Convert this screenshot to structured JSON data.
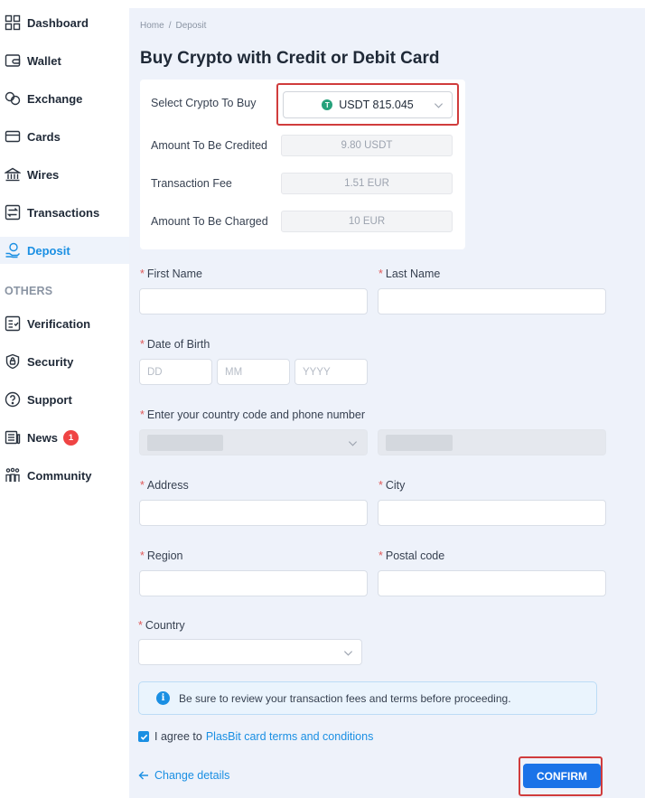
{
  "sidebar": {
    "items": [
      {
        "label": "Dashboard",
        "icon": "dashboard-icon"
      },
      {
        "label": "Wallet",
        "icon": "wallet-icon"
      },
      {
        "label": "Exchange",
        "icon": "exchange-icon"
      },
      {
        "label": "Cards",
        "icon": "card-icon"
      },
      {
        "label": "Wires",
        "icon": "bank-icon"
      },
      {
        "label": "Transactions",
        "icon": "transactions-icon"
      },
      {
        "label": "Deposit",
        "icon": "deposit-icon",
        "active": true
      }
    ],
    "section_label": "OTHERS",
    "other_items": [
      {
        "label": "Verification",
        "icon": "verification-icon"
      },
      {
        "label": "Security",
        "icon": "lock-icon"
      },
      {
        "label": "Support",
        "icon": "help-icon"
      },
      {
        "label": "News",
        "icon": "news-icon",
        "badge": "1"
      },
      {
        "label": "Community",
        "icon": "community-icon"
      }
    ]
  },
  "breadcrumb": {
    "home": "Home",
    "separator": "/",
    "current": "Deposit"
  },
  "page_title": "Buy Crypto with Credit or Debit Card",
  "summary": {
    "select_label": "Select Crypto To Buy",
    "selected_coin": "USDT 815.045",
    "coin_symbol": "T",
    "credited_label": "Amount To Be Credited",
    "credited_value": "9.80 USDT",
    "fee_label": "Transaction Fee",
    "fee_value": "1.51 EUR",
    "charged_label": "Amount To Be Charged",
    "charged_value": "10 EUR"
  },
  "form": {
    "required_mark": "*",
    "first_name_label": "First Name",
    "last_name_label": "Last Name",
    "dob_label": "Date of Birth",
    "dob_day_placeholder": "DD",
    "dob_month_placeholder": "MM",
    "dob_year_placeholder": "YYYY",
    "phone_label": "Enter your country code and phone number",
    "address_label": "Address",
    "city_label": "City",
    "region_label": "Region",
    "postal_label": "Postal code",
    "country_label": "Country"
  },
  "notice": {
    "icon_glyph": "i",
    "text": "Be sure to review your transaction fees and terms before proceeding."
  },
  "agreement": {
    "text": "I agree to",
    "link": "PlasBit card terms and conditions",
    "checked": true
  },
  "actions": {
    "change_label": "Change details",
    "confirm_label": "CONFIRM"
  },
  "colors": {
    "accent": "#1a8fe3",
    "confirm": "#1a73e8",
    "highlight": "#d03c3c",
    "badge": "#ef4444",
    "usdt": "#26a17b"
  }
}
